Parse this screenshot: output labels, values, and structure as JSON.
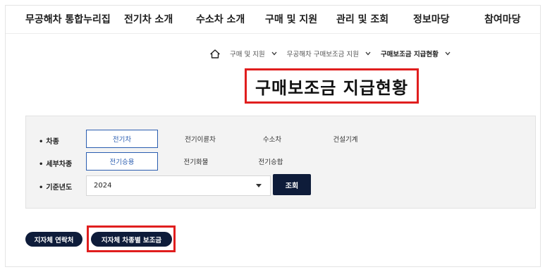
{
  "nav": {
    "items": [
      {
        "label": "무공해차 통합누리집"
      },
      {
        "label": "전기차 소개"
      },
      {
        "label": "수소차 소개"
      },
      {
        "label": "구매 및 지원"
      },
      {
        "label": "관리 및 조회"
      },
      {
        "label": "정보마당"
      },
      {
        "label": "참여마당"
      }
    ]
  },
  "breadcrumb": {
    "home_icon": "home-icon",
    "items": [
      {
        "label": "구매 및 지원"
      },
      {
        "label": "무공해차 구매보조금 지원"
      },
      {
        "label": "구매보조금 지급현황"
      }
    ]
  },
  "page": {
    "title": "구매보조금 지급현황"
  },
  "filters": {
    "vehicle_type": {
      "label": "차종",
      "options": [
        "전기차",
        "전기이륜차",
        "수소차",
        "건설기계"
      ],
      "selected": "전기차"
    },
    "sub_type": {
      "label": "세부차종",
      "options": [
        "전기승용",
        "전기화물",
        "전기승합"
      ],
      "selected": "전기승용"
    },
    "year": {
      "label": "기준년도",
      "value": "2024"
    },
    "search_label": "조회"
  },
  "actions": {
    "contacts_label": "지자체 연락처",
    "subsidy_label": "지자체 차종별 보조금"
  },
  "colors": {
    "accent": "#2a5db0",
    "dark_button": "#0e1c3a",
    "highlight": "#e01e1e"
  }
}
